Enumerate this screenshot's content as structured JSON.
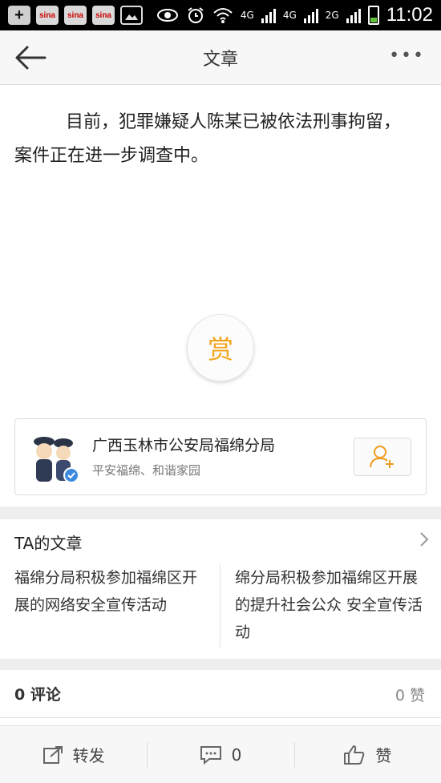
{
  "status_bar": {
    "sina_label": "sina",
    "network_a": "4G",
    "network_b": "4G",
    "network_c": "2G",
    "time": "11:02",
    "battery_color": "#62c13a"
  },
  "header": {
    "title": "文章",
    "more": "•••",
    "back_icon": "arrow-left-icon"
  },
  "article": {
    "text": "目前，犯罪嫌疑人陈某已被依法刑事拘留，案件正在进一步调查中。"
  },
  "reward": {
    "label": "赏",
    "color": "#f3a41c"
  },
  "author": {
    "name": "广西玉林市公安局福绵分局",
    "description": "平安福绵、和谐家园",
    "follow_icon": "add-user-icon",
    "verified_color": "#3d8be0"
  },
  "ta_articles": {
    "header": "TA的文章",
    "items": [
      "福绵分局积极参加福绵区开展的网络安全宣传活动",
      "绵分局积极参加福绵区开展的提升社会公众 安全宣传活动"
    ]
  },
  "comments": {
    "left": "0 评论",
    "right": "0 赞"
  },
  "bottom_bar": {
    "repost_label": "转发",
    "comment_count": "0",
    "like_label": "赞"
  }
}
